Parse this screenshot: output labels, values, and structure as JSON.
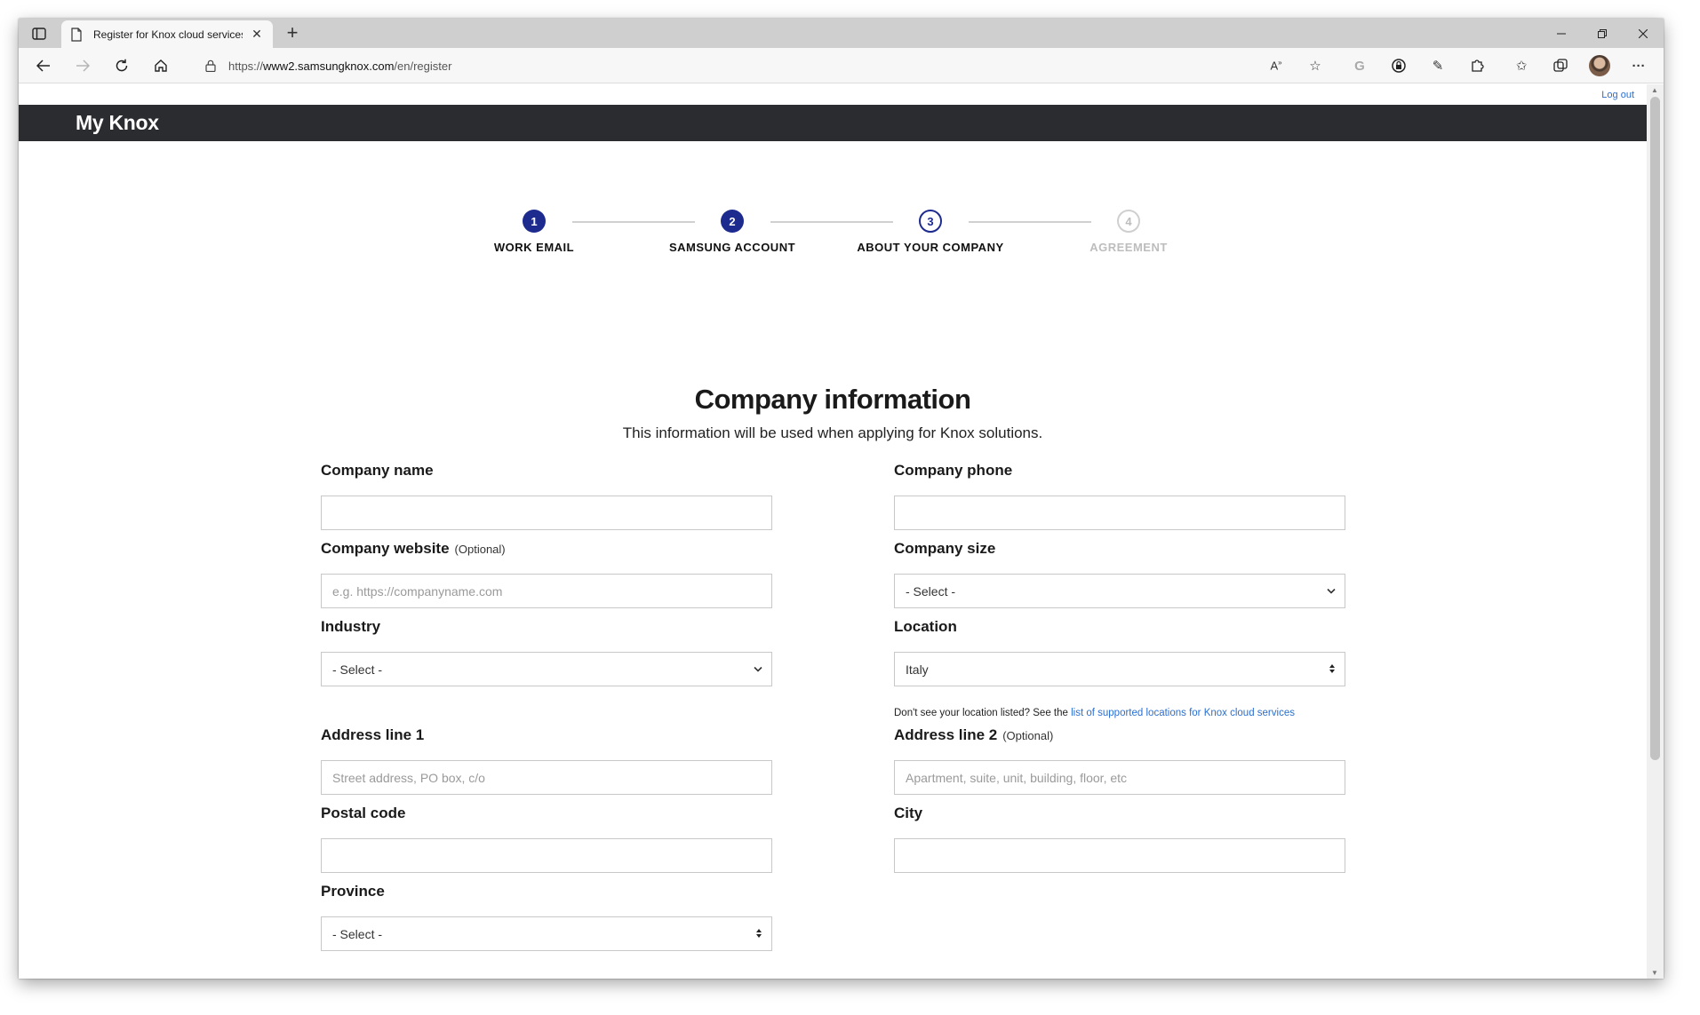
{
  "browser": {
    "tab_title": "Register for Knox cloud services",
    "url_prefix": "https://",
    "url_host": "www2.samsungknox.com",
    "url_path": "/en/register"
  },
  "site": {
    "logout_label": "Log out",
    "logo": "My Knox"
  },
  "stepper": {
    "steps": [
      {
        "number": "1",
        "label": "WORK EMAIL",
        "state": "done"
      },
      {
        "number": "2",
        "label": "SAMSUNG ACCOUNT",
        "state": "done"
      },
      {
        "number": "3",
        "label": "ABOUT YOUR COMPANY",
        "state": "current"
      },
      {
        "number": "4",
        "label": "AGREEMENT",
        "state": "future"
      }
    ]
  },
  "form": {
    "title": "Company information",
    "subtitle": "This information will be used when applying for Knox solutions.",
    "optional_tag": "(Optional)",
    "company_name": {
      "label": "Company name",
      "value": ""
    },
    "company_phone": {
      "label": "Company phone",
      "value": ""
    },
    "company_website": {
      "label": "Company website",
      "placeholder": "e.g. https://companyname.com"
    },
    "company_size": {
      "label": "Company size",
      "selected": "- Select -"
    },
    "industry": {
      "label": "Industry",
      "selected": "- Select -"
    },
    "location": {
      "label": "Location",
      "selected": "Italy",
      "hint_text": "Don't see your location listed? See the",
      "hint_link": "list of supported locations for Knox cloud services"
    },
    "address1": {
      "label": "Address line 1",
      "placeholder": "Street address, PO box, c/o"
    },
    "address2": {
      "label": "Address line 2",
      "placeholder": "Apartment, suite, unit, building, floor, etc"
    },
    "postal_code": {
      "label": "Postal code",
      "value": ""
    },
    "city": {
      "label": "City",
      "value": ""
    },
    "province": {
      "label": "Province",
      "selected": "- Select -"
    }
  },
  "colors": {
    "brand_header": "#2b2c30",
    "step_active": "#1d2b8f",
    "link": "#2a6fd1"
  }
}
